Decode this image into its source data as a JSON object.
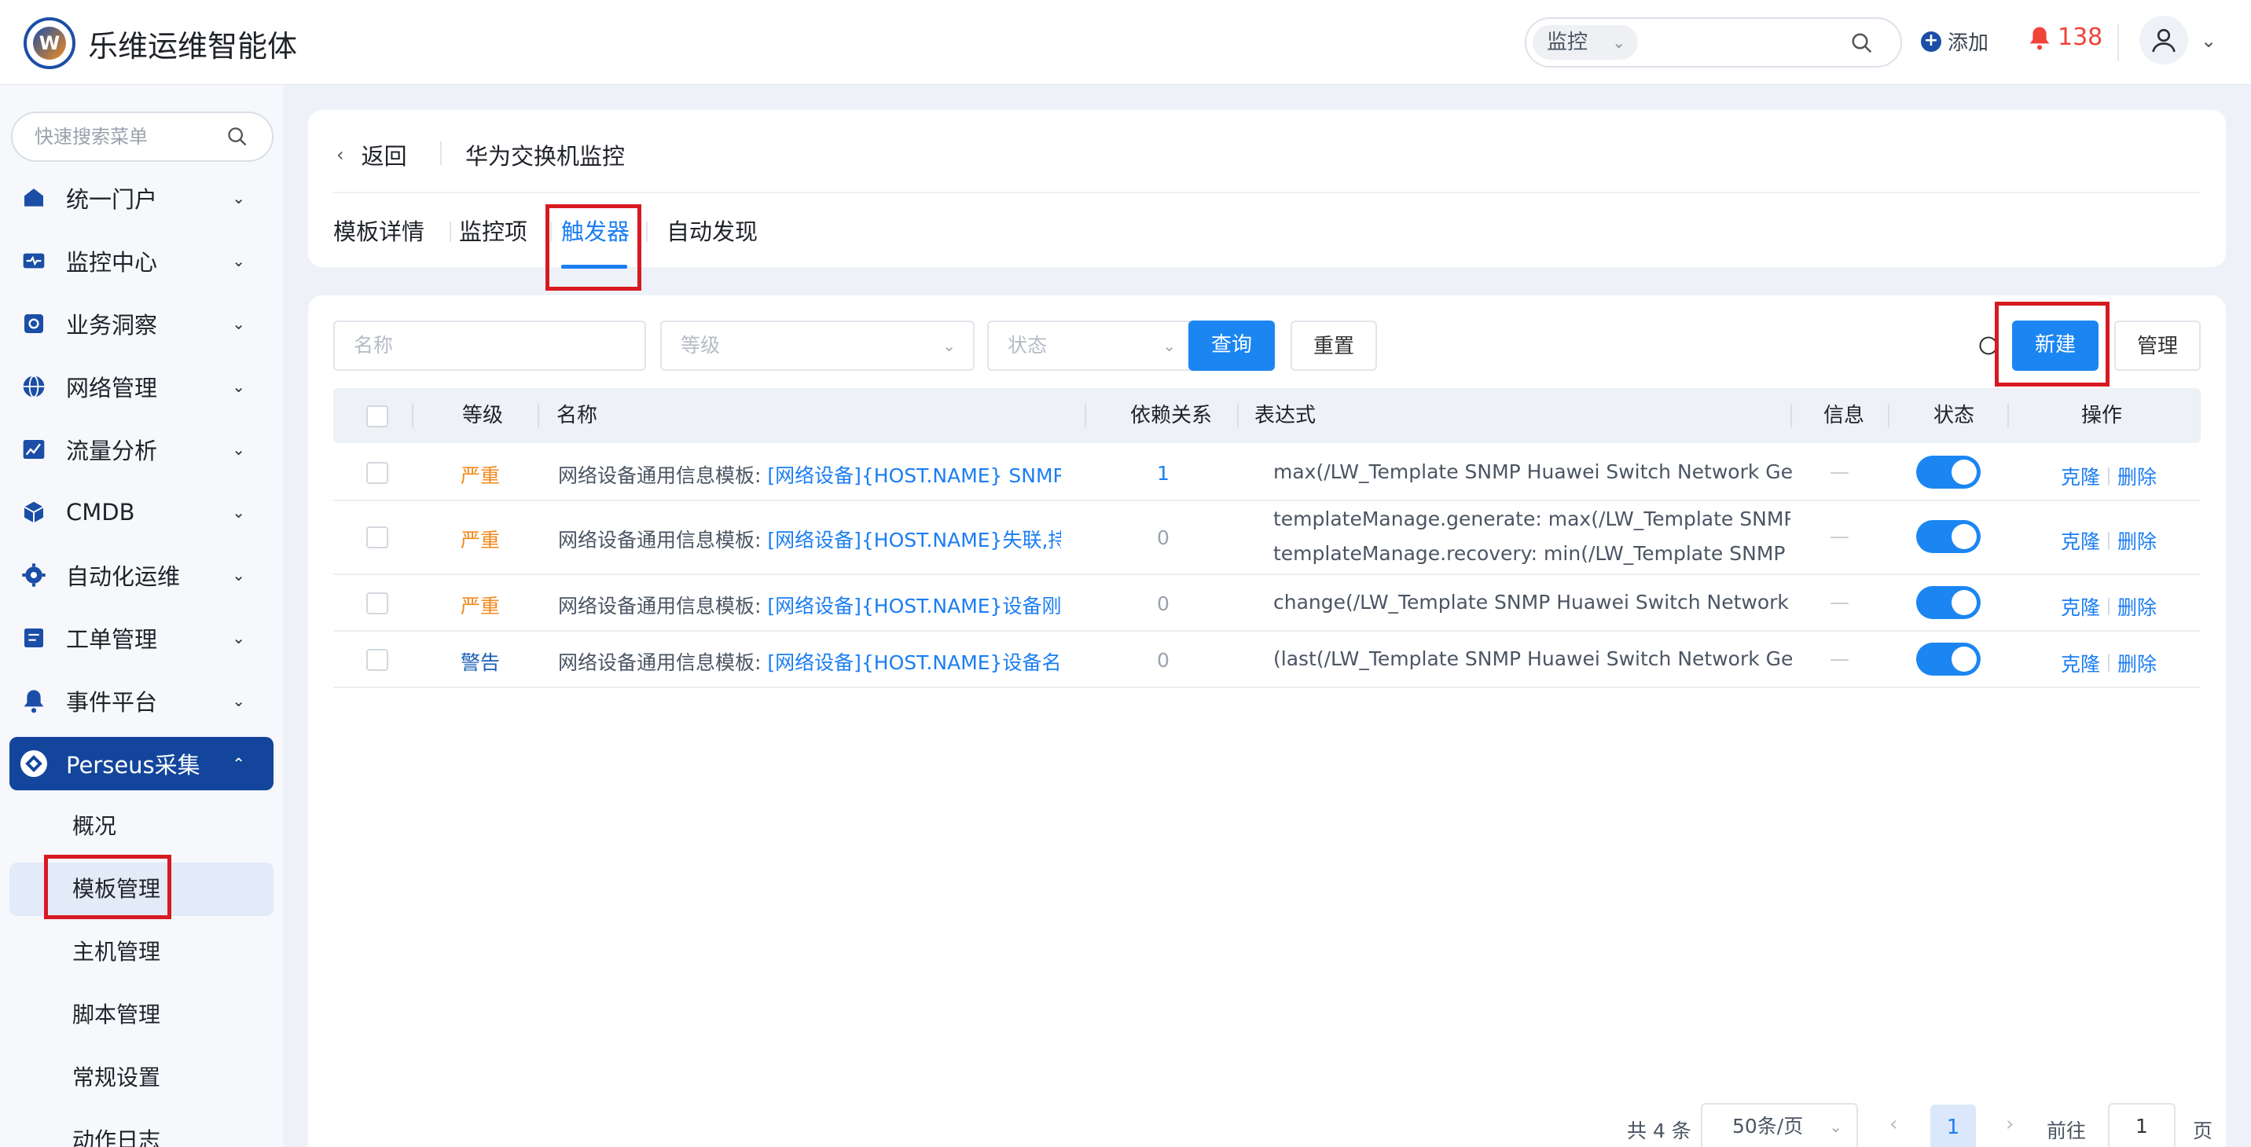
{
  "app": {
    "title": "乐维运维智能体",
    "logo_letter": "W"
  },
  "header": {
    "search_scope": "监控",
    "add_label": "添加",
    "alert_count": "138"
  },
  "sidebar": {
    "search_placeholder": "快速搜索菜单",
    "items": [
      {
        "label": "统一门户",
        "icon": "home-icon"
      },
      {
        "label": "监控中心",
        "icon": "monitor-icon"
      },
      {
        "label": "业务洞察",
        "icon": "insight-icon"
      },
      {
        "label": "网络管理",
        "icon": "globe-icon"
      },
      {
        "label": "流量分析",
        "icon": "chart-icon"
      },
      {
        "label": "CMDB",
        "icon": "cube-icon"
      },
      {
        "label": "自动化运维",
        "icon": "gear-icon"
      },
      {
        "label": "工单管理",
        "icon": "ticket-icon"
      },
      {
        "label": "事件平台",
        "icon": "bell-icon"
      },
      {
        "label": "Perseus采集",
        "icon": "collect-icon"
      }
    ],
    "sub_items": [
      "概况",
      "模板管理",
      "主机管理",
      "脚本管理",
      "常规设置",
      "动作日志"
    ]
  },
  "page": {
    "back_label": "返回",
    "title": "华为交换机监控",
    "tabs": [
      "模板详情",
      "监控项",
      "触发器",
      "自动发现"
    ],
    "active_tab": "触发器"
  },
  "filters": {
    "name_placeholder": "名称",
    "level_placeholder": "等级",
    "status_placeholder": "状态",
    "query_label": "查询",
    "reset_label": "重置",
    "new_label": "新建",
    "manage_label": "管理"
  },
  "table": {
    "columns": [
      "等级",
      "名称",
      "依赖关系",
      "表达式",
      "信息",
      "状态",
      "操作"
    ],
    "rows": [
      {
        "level": "严重",
        "name_prefix": "网络设备通用信息模板: ",
        "name_link": "[网络设备]{HOST.NAME} SNMP...",
        "dependency": "1",
        "expression": "max(/LW_Template SNMP Huawei Switch Network Ge...",
        "expression2": "",
        "info": "—",
        "enabled": true,
        "clone": "克隆",
        "delete": "删除"
      },
      {
        "level": "严重",
        "name_prefix": "网络设备通用信息模板: ",
        "name_link": "[网络设备]{HOST.NAME}失联,持...",
        "dependency": "0",
        "expression": "templateManage.generate: max(/LW_Template SNMP Hua",
        "expression2": "templateManage.recovery: min(/LW_Template SNMP Huav",
        "info": "—",
        "enabled": true,
        "clone": "克隆",
        "delete": "删除"
      },
      {
        "level": "严重",
        "name_prefix": "网络设备通用信息模板: ",
        "name_link": "[网络设备]{HOST.NAME}设备刚发...",
        "dependency": "0",
        "expression": "change(/LW_Template SNMP Huawei Switch Network ...",
        "expression2": "",
        "info": "—",
        "enabled": true,
        "clone": "克隆",
        "delete": "删除"
      },
      {
        "level": "警告",
        "name_prefix": "网络设备通用信息模板: ",
        "name_link": "[网络设备]{HOST.NAME}设备名称...",
        "dependency": "0",
        "expression": "(last(/LW_Template SNMP Huawei Switch Network Ge...",
        "expression2": "",
        "info": "—",
        "enabled": true,
        "clone": "克隆",
        "delete": "删除"
      }
    ]
  },
  "pagination": {
    "total": "共 4 条",
    "page_size": "50条/页",
    "current_page": "1",
    "goto_label": "前往",
    "goto_value": "1",
    "page_suffix": "页"
  },
  "colors": {
    "accent": "#1b86f2",
    "sidebar_active": "#13459c",
    "severe": "#f08a1c",
    "warning": "#1b5fb5",
    "highlight_box": "#d71921"
  }
}
